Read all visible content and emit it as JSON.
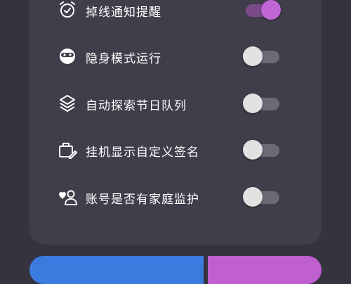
{
  "settings": {
    "items": [
      {
        "label": "掉线通知提醒",
        "icon": "alarm-clock-icon",
        "enabled": true
      },
      {
        "label": "隐身模式运行",
        "icon": "incognito-mask-icon",
        "enabled": false
      },
      {
        "label": "自动探索节日队列",
        "icon": "layers-icon",
        "enabled": false
      },
      {
        "label": "挂机显示自定义签名",
        "icon": "briefcase-edit-icon",
        "enabled": false
      },
      {
        "label": "账号是否有家庭监护",
        "icon": "guardian-heart-icon",
        "enabled": false
      }
    ]
  },
  "colors": {
    "background": "#34333f",
    "card": "#3f3e4a",
    "toggle_on": "#c266d6",
    "toggle_off": "#e2e2e2",
    "button_primary": "#3b7be0",
    "button_secondary": "#c05fcf"
  }
}
